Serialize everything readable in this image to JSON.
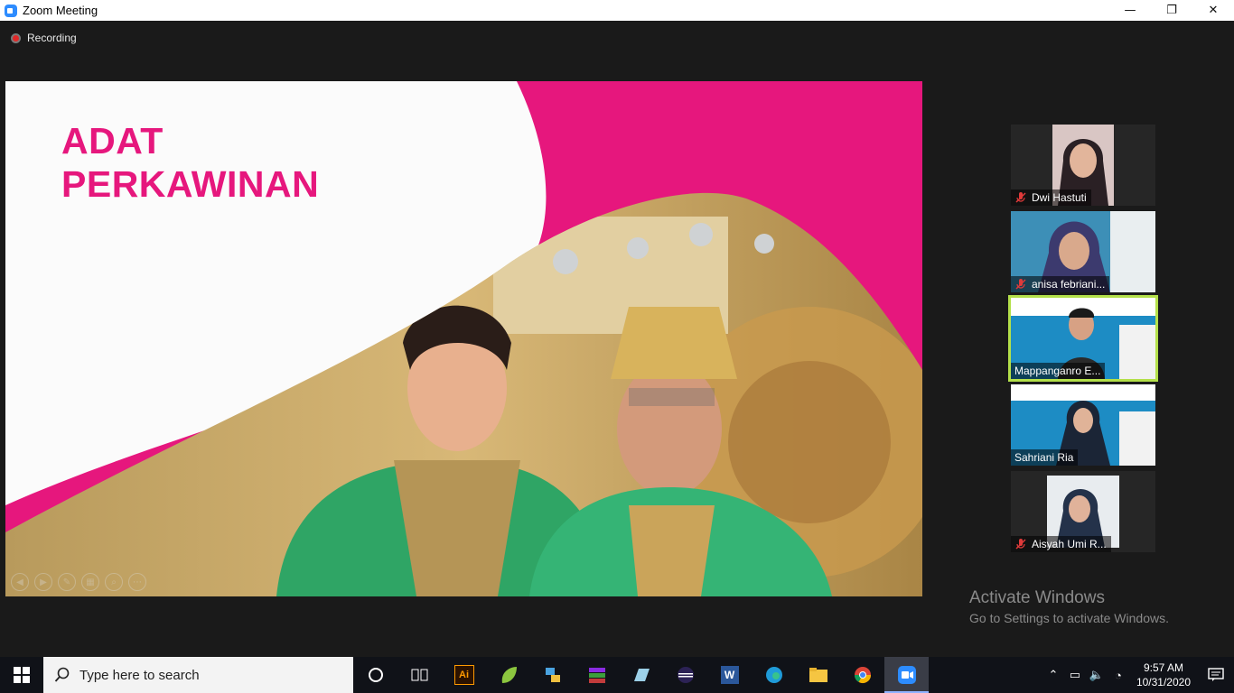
{
  "window": {
    "title": "Zoom Meeting",
    "minimize": "—",
    "restore": "❐",
    "close": "✕"
  },
  "recording": {
    "label": "Recording"
  },
  "slide": {
    "title_line1": "ADAT",
    "title_line2": "PERKAWINAN",
    "accent_color": "#e6177d"
  },
  "participants": [
    {
      "name": "Dwi Hastuti",
      "muted": true
    },
    {
      "name": "anisa febriani...",
      "muted": true
    },
    {
      "name": "Mappanganro E...",
      "muted": false,
      "active_speaker": true
    },
    {
      "name": "Sahriani Ria",
      "muted": false
    },
    {
      "name": "Aisyah Umi R...",
      "muted": true
    }
  ],
  "watermark": {
    "line1": "Activate Windows",
    "line2": "Go to Settings to activate Windows."
  },
  "taskbar": {
    "search_placeholder": "Type here to search",
    "apps": [
      "cortana-icon",
      "task-view-icon",
      "illustrator-icon",
      "app-icon",
      "network-app-icon",
      "winrar-icon",
      "notes-icon",
      "eclipse-icon",
      "word-icon",
      "edge-icon",
      "file-explorer-icon",
      "chrome-icon",
      "zoom-icon"
    ],
    "time": "9:57 AM",
    "date": "10/31/2020"
  }
}
